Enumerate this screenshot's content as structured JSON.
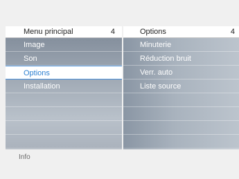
{
  "left_panel": {
    "title": "Menu principal",
    "count": "4",
    "items": [
      {
        "label": "Image"
      },
      {
        "label": "Son"
      },
      {
        "label": "Options"
      },
      {
        "label": "Installation"
      }
    ],
    "selected_index": 2
  },
  "right_panel": {
    "title": "Options",
    "count": "4",
    "items": [
      {
        "label": "Minuterie"
      },
      {
        "label": "Réduction bruit"
      },
      {
        "label": "Verr. auto"
      },
      {
        "label": "Liste source"
      }
    ]
  },
  "footer": {
    "info_label": "Info"
  },
  "colors": {
    "selected_text": "#2b7fd0",
    "selected_border": "#4a90d9"
  }
}
